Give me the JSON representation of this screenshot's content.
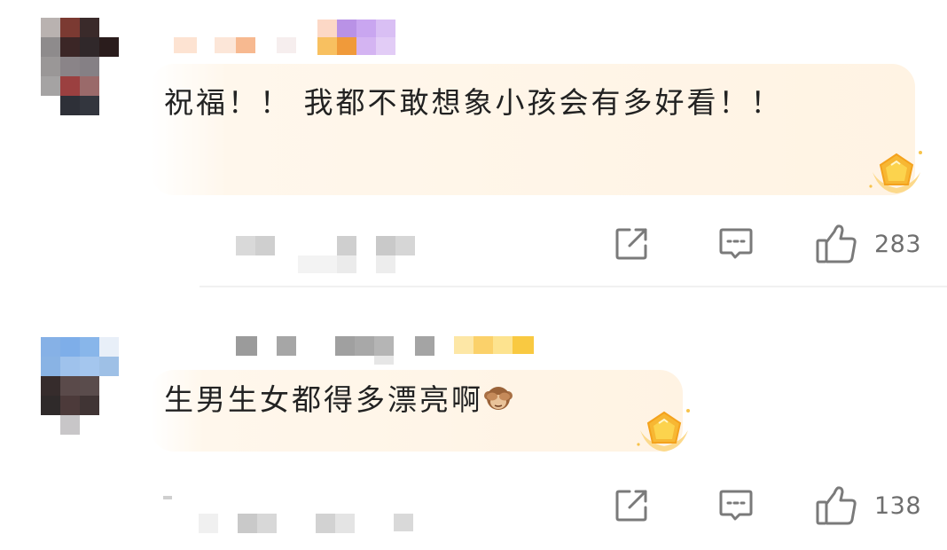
{
  "comments": [
    {
      "text": "祝福！！ 我都不敢想象小孩会有多好看！！",
      "likes": "283"
    },
    {
      "text": "生男生女都得多漂亮啊",
      "emoji": "see-no-evil-monkey",
      "likes": "138"
    }
  ],
  "colors": {
    "icon": "#7a7a7a",
    "count": "#6f6f6f",
    "bubble": "#fff5e8",
    "badge": "#f7b733"
  }
}
